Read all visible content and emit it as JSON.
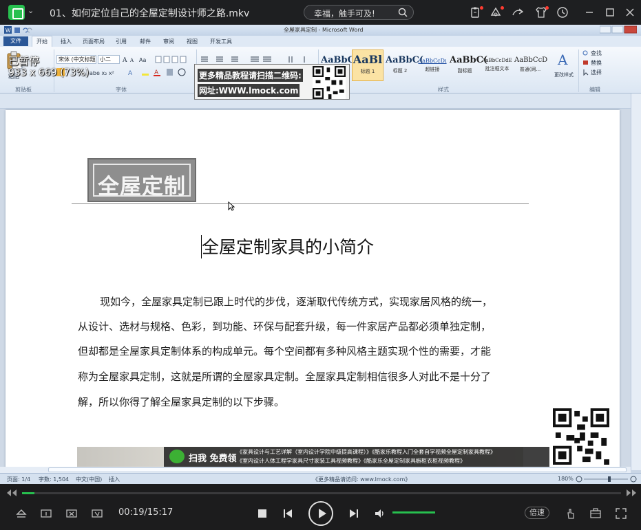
{
  "player": {
    "file_title": "01、如何定位自己的全屋定制设计师之路.mkv",
    "search_text": "幸福，触手可及!",
    "status_paused": "已暂停",
    "resolution": "933 x 669 (73%)",
    "time": "00:19/15:17",
    "progress_fraction": 0.0207,
    "volume_fraction": 1.0,
    "speed_label": "倍速",
    "accent_color": "#27c04f"
  },
  "word": {
    "window_title": "全屋家具定制 - Microsoft Word",
    "tabs": [
      "文件",
      "开始",
      "插入",
      "页面布局",
      "引用",
      "邮件",
      "审阅",
      "视图",
      "开发工具"
    ],
    "ribbon": {
      "paste_label": "粘贴",
      "font_name": "宋体 (中文标题",
      "font_size": "小二",
      "group_clipboard": "剪贴板",
      "group_font": "字体",
      "group_styles": "样式",
      "group_editing": "编辑",
      "styles": [
        {
          "sample": "AaBbC(",
          "name": "标题"
        },
        {
          "sample": "AaBl",
          "name": "标题 1"
        },
        {
          "sample": "AaBbC(",
          "name": "标题 2"
        },
        {
          "sample": "AaBbCcDı",
          "name": "超链接"
        },
        {
          "sample": "AaBbC(",
          "name": "副标题"
        },
        {
          "sample": "AaBbCcDdE",
          "name": "批注框文本"
        },
        {
          "sample": "AaBbCcD",
          "name": "普通(网..."
        }
      ],
      "change_styles": "更改样式",
      "find": "查找",
      "replace": "替换",
      "select": "选择"
    },
    "document": {
      "logo_text": "全屋定制",
      "title": "全屋定制家具的小简介",
      "paragraph_lines": [
        "现如今，全屋家具定制已跟上时代的步伐，逐渐取代传统方式，实现家居风格的统一，",
        "从设计、选材与规格、色彩，到功能、环保与配套升级，每一件家居产品都必须单独定制，",
        "但却都是全屋家具定制体系的构成单元。每个空间都有多种风格主题实现个性的需要，才能",
        "称为全屋家具定制，这就是所谓的全屋家具定制。全屋家具定制相信很多人对此不是十分了",
        "解，所以你得了解全屋家具定制的以下步骤。"
      ]
    },
    "status": {
      "page": "页面: 1/4",
      "words": "字数: 1,504",
      "language": "中文(中国)",
      "insert": "插入",
      "zoom": "180%",
      "site": "《更多精品请访问: www.lmock.com》"
    }
  },
  "overlays": {
    "ad_line1": "更多精品教程请扫描二维码:",
    "ad_line2": "网址:WWW.lmock.com",
    "promo_lead": "扫我 免费领",
    "promo_line1": "《家具设计与工艺详解（室内设计学院中级提高课程）》《酷家乐教程入门全套自学视频全屋定制家具教程》",
    "promo_line2": "《室内设计人体工程学家具尺寸家装工具视频教程》《酷家乐全屋定制家具橱柜衣柜视频教程》"
  }
}
